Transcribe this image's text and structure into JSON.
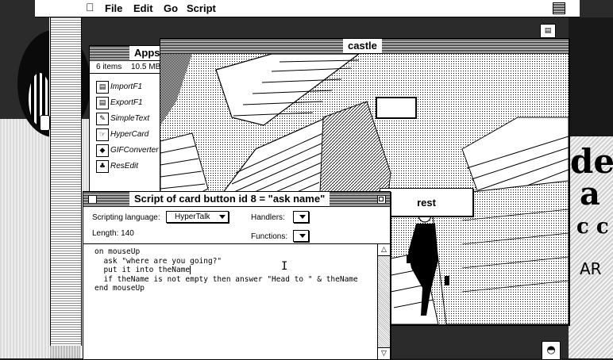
{
  "menubar": {
    "apple": "",
    "items": [
      "File",
      "Edit",
      "Go",
      "Script"
    ]
  },
  "apps_window": {
    "title": "Apps",
    "item_count": "6 items",
    "disk_size": "10.5 MB",
    "items": [
      {
        "label": "ImportF1",
        "icon": "document-icon"
      },
      {
        "label": "ExportF1",
        "icon": "document-icon"
      },
      {
        "label": "SimpleText",
        "icon": "app-icon"
      },
      {
        "label": "HyperCard",
        "icon": "hand-icon"
      },
      {
        "label": "GIFConverter",
        "icon": "app-icon"
      },
      {
        "label": "ResEdit",
        "icon": "jack-in-box-icon"
      }
    ]
  },
  "card_window": {
    "title": "castle",
    "rest_button_label": "rest"
  },
  "script_window": {
    "title": "Script of card button id 8 = \"ask name\"",
    "scripting_language_label": "Scripting language:",
    "scripting_language_value": "HyperTalk",
    "handlers_label": "Handlers:",
    "functions_label": "Functions:",
    "length_text": "Length: 140",
    "script_lines": [
      "on mouseUp",
      "  ask \"where are you going?\"",
      "  put it into theName",
      "  if theName is not empty then answer \"Head to \" & theName",
      "end mouseUp"
    ]
  }
}
